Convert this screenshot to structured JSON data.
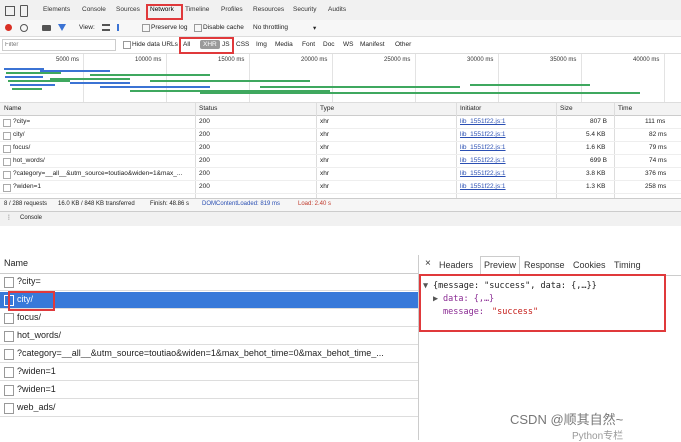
{
  "top_panel": {
    "tabs": [
      "Elements",
      "Console",
      "Sources",
      "Network",
      "Timeline",
      "Profiles",
      "Resources",
      "Security",
      "Audits"
    ],
    "toolbar": {
      "view_label": "View:",
      "preserve_log": "Preserve log",
      "disable_cache": "Disable cache",
      "throttle": "No throttling"
    },
    "filter": {
      "placeholder": "Filter",
      "hide_data_urls": "Hide data URLs",
      "types": [
        "All",
        "XHR",
        "JS",
        "CSS",
        "Img",
        "Media",
        "Font",
        "Doc",
        "WS",
        "Manifest",
        "Other"
      ]
    },
    "timeline_ticks": [
      "5000 ms",
      "10000 ms",
      "15000 ms",
      "20000 ms",
      "25000 ms",
      "30000 ms",
      "35000 ms",
      "40000 ms"
    ],
    "columns": [
      "Name",
      "Status",
      "Type",
      "Initiator",
      "Size",
      "Time"
    ],
    "rows": [
      {
        "name": "?city=",
        "status": "200",
        "type": "xhr",
        "initiator": "lib_1551f22.js:1",
        "size": "807 B",
        "time": "111 ms"
      },
      {
        "name": "city/",
        "status": "200",
        "type": "xhr",
        "initiator": "lib_1551f22.js:1",
        "size": "5.4 KB",
        "time": "82 ms"
      },
      {
        "name": "focus/",
        "status": "200",
        "type": "xhr",
        "initiator": "lib_1551f22.js:1",
        "size": "1.6 KB",
        "time": "79 ms"
      },
      {
        "name": "hot_words/",
        "status": "200",
        "type": "xhr",
        "initiator": "lib_1551f22.js:1",
        "size": "699 B",
        "time": "74 ms"
      },
      {
        "name": "?category=__all__&utm_source=toutiao&widen=1&max_...",
        "status": "200",
        "type": "xhr",
        "initiator": "lib_1551f22.js:1",
        "size": "3.8 KB",
        "time": "376 ms"
      },
      {
        "name": "?widen=1",
        "status": "200",
        "type": "xhr",
        "initiator": "lib_1551f22.js:1",
        "size": "1.3 KB",
        "time": "258 ms"
      }
    ],
    "status": {
      "requests": "8 / 288 requests",
      "transferred": "16.0 KB / 848 KB transferred",
      "finish": "Finish: 48.86 s",
      "dcl": "DOMContentLoaded: 819 ms",
      "load": "Load: 2.40 s"
    },
    "drawer_tab": "Console"
  },
  "bottom_panel": {
    "name_header": "Name",
    "rows": [
      {
        "name": "?city=",
        "selected": false
      },
      {
        "name": "city/",
        "selected": true
      },
      {
        "name": "focus/",
        "selected": false
      },
      {
        "name": "hot_words/",
        "selected": false
      },
      {
        "name": "?category=__all__&utm_source=toutiao&widen=1&max_behot_time=0&max_behot_time_...",
        "selected": false
      },
      {
        "name": "?widen=1",
        "selected": false
      },
      {
        "name": "?widen=1",
        "selected": false
      },
      {
        "name": "web_ads/",
        "selected": false
      }
    ],
    "detail_tabs": [
      "Headers",
      "Preview",
      "Response",
      "Cookies",
      "Timing"
    ],
    "active_detail_tab": "Preview",
    "close_glyph": "×",
    "preview": {
      "root": "{message: \"success\", data: {,…}}",
      "data_line": "data: {,…}",
      "message_key": "message:",
      "message_value": "\"success\""
    }
  },
  "watermark": {
    "csdn": "CSDN @顺其自然~",
    "wechat": "Python专栏"
  },
  "colors": {
    "highlight_red": "#e0393b",
    "selected_blue": "#3879d9",
    "link_blue": "#2a4fb3",
    "json_key_purple": "#8b2c94",
    "json_string_red": "#c41a16"
  }
}
